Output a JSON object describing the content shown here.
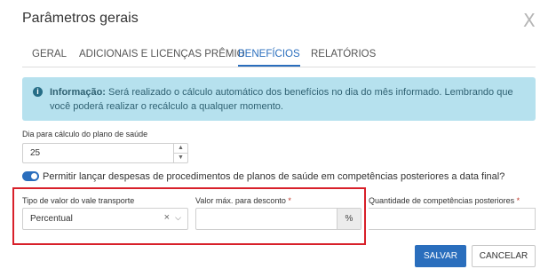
{
  "dialog": {
    "title": "Parâmetros gerais",
    "close_label": "X"
  },
  "tabs": [
    {
      "label": "GERAL",
      "active": false
    },
    {
      "label": "ADICIONAIS E LICENÇAS PRÊMIO",
      "active": false
    },
    {
      "label": "BENEFÍCIOS",
      "active": true
    },
    {
      "label": "RELATÓRIOS",
      "active": false
    }
  ],
  "info": {
    "icon": "info-icon",
    "bold": "Informação:",
    "text": " Será realizado o cálculo automático dos benefícios no dia do mês informado. Lembrando que você poderá realizar o recálculo a qualquer momento."
  },
  "plano": {
    "label": "Dia para cálculo do plano de saúde",
    "value": "25"
  },
  "toggle": {
    "on": true,
    "label": "Permitir lançar despesas de procedimentos de planos de saúde em competências posteriores a data final?"
  },
  "vale": {
    "label": "Tipo de valor do vale transporte",
    "value": "Percentual"
  },
  "desconto": {
    "label": "Valor máx. para desconto",
    "required": "*",
    "value": "",
    "addon": "%"
  },
  "quantidade": {
    "label": "Quantidade de competências posteriores",
    "required": "*",
    "value": ""
  },
  "buttons": {
    "save": "SALVAR",
    "cancel": "CANCELAR"
  },
  "colors": {
    "accent": "#2a6ebd",
    "info_bg": "#b6e1ee",
    "highlight": "#d8202a"
  }
}
